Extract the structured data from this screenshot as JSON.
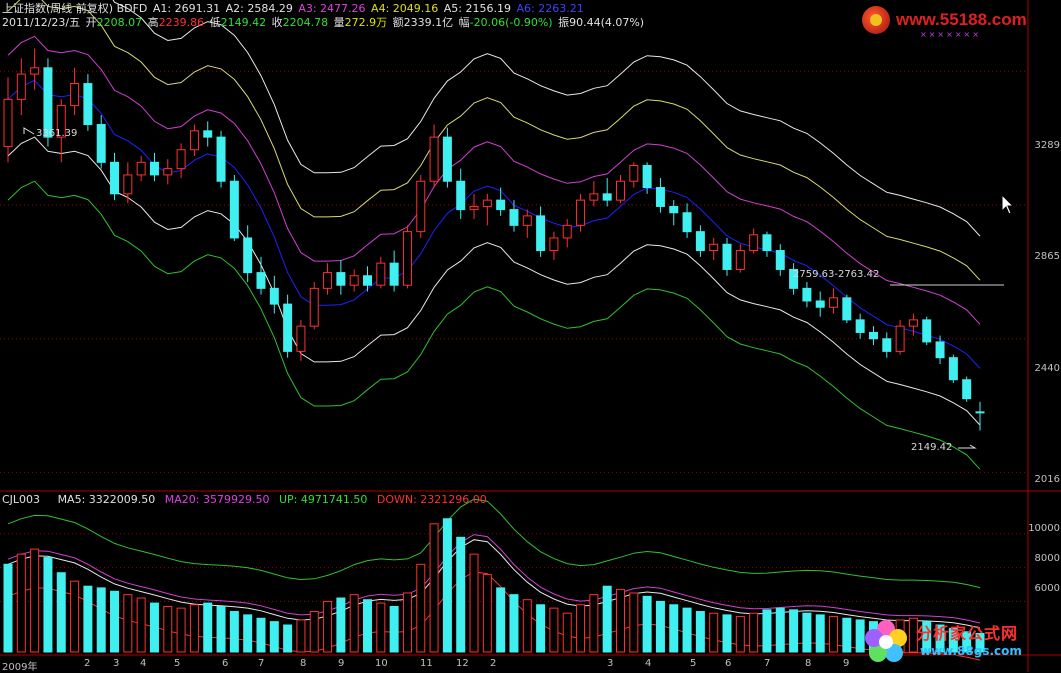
{
  "header": {
    "title": "上证指数(周线 前复权) BDFD",
    "params": [
      {
        "label": "A1: 2691.31",
        "color": "#e0e0e0"
      },
      {
        "label": "A2: 2584.29",
        "color": "#e0e0e0"
      },
      {
        "label": "A3: 2477.26",
        "color": "#e040e0"
      },
      {
        "label": "A4: 2049.16",
        "color": "#e0e000"
      },
      {
        "label": "A5: 2156.19",
        "color": "#e0e0e0"
      },
      {
        "label": "A6: 2263.21",
        "color": "#4040ff"
      }
    ],
    "date": "2011/12/23/五",
    "open": {
      "label": "开",
      "value": "2208.07"
    },
    "high": {
      "label": "高",
      "value": "2239.86"
    },
    "low": {
      "label": "低",
      "value": "2149.42"
    },
    "close": {
      "label": "收",
      "value": "2204.78"
    },
    "volume": {
      "label": "量",
      "value": "272.9万"
    },
    "amount": {
      "label": "额",
      "value": "2339.1亿"
    },
    "change": {
      "label": "幅",
      "value": "-20.06(-0.90%)"
    },
    "swing": {
      "label": "振",
      "value": "90.44(4.07%)"
    }
  },
  "indicator": {
    "name": "CJL003",
    "ma5": "MA5: 3322009.50",
    "ma20": "MA20: 3579929.50",
    "up": "UP: 4971741.50",
    "down": "DOWN: 2321296.00"
  },
  "price_axis": {
    "labels": [
      "3289",
      "2865",
      "2440",
      "2016"
    ],
    "values": [
      3289,
      2865,
      2440,
      2016
    ]
  },
  "volume_axis": {
    "labels": [
      "10000",
      "8000",
      "6000"
    ],
    "values": [
      10000,
      8000,
      6000
    ]
  },
  "time_axis": {
    "labels": [
      "2009年",
      "2",
      "3",
      "4",
      "5",
      "6",
      "7",
      "8",
      "9",
      "10",
      "11",
      "12",
      "2",
      "3",
      "4",
      "5",
      "6",
      "7",
      "8",
      "9"
    ]
  },
  "annotations": {
    "high_mark": "3361.39",
    "low_mark": "2149.42",
    "range_mark": "2759.63-2763.42"
  },
  "logos": {
    "top": "www.55188.com",
    "top_stars": "×××××××",
    "bottom_text": "分析家公式网",
    "bottom_url": "www.88gs.com"
  },
  "colors": {
    "up_candle": "#ff3030",
    "down_candle": "#40f0f0",
    "blue_line": "#2020ff",
    "magenta_line": "#d040d0",
    "yellow_line": "#d8d870",
    "white_line": "#e8e8e8",
    "green_line": "#30c030",
    "frame": "#b00000"
  },
  "chart_data": {
    "type": "candlestick",
    "price_ylim": [
      1960,
      3420
    ],
    "volume_ylim": [
      3000,
      11300
    ],
    "candles": [
      [
        3050,
        3270,
        3000,
        3200
      ],
      [
        3200,
        3330,
        3150,
        3280
      ],
      [
        3280,
        3361,
        3230,
        3300
      ],
      [
        3300,
        3330,
        3050,
        3080
      ],
      [
        3080,
        3200,
        3000,
        3180
      ],
      [
        3180,
        3300,
        3150,
        3250
      ],
      [
        3250,
        3280,
        3100,
        3120
      ],
      [
        3120,
        3150,
        2980,
        3000
      ],
      [
        3000,
        3030,
        2880,
        2900
      ],
      [
        2900,
        3000,
        2870,
        2960
      ],
      [
        2960,
        3020,
        2940,
        3000
      ],
      [
        3000,
        3030,
        2940,
        2960
      ],
      [
        2960,
        3010,
        2930,
        2980
      ],
      [
        2980,
        3060,
        2950,
        3040
      ],
      [
        3040,
        3120,
        3020,
        3100
      ],
      [
        3100,
        3130,
        3050,
        3080
      ],
      [
        3080,
        3100,
        2920,
        2940
      ],
      [
        2940,
        2960,
        2750,
        2760
      ],
      [
        2760,
        2800,
        2620,
        2650
      ],
      [
        2650,
        2700,
        2580,
        2600
      ],
      [
        2600,
        2640,
        2520,
        2550
      ],
      [
        2550,
        2580,
        2380,
        2400
      ],
      [
        2400,
        2500,
        2370,
        2480
      ],
      [
        2480,
        2620,
        2470,
        2600
      ],
      [
        2600,
        2680,
        2580,
        2650
      ],
      [
        2650,
        2690,
        2580,
        2610
      ],
      [
        2610,
        2660,
        2590,
        2640
      ],
      [
        2640,
        2670,
        2590,
        2610
      ],
      [
        2610,
        2700,
        2600,
        2680
      ],
      [
        2680,
        2720,
        2590,
        2610
      ],
      [
        2610,
        2800,
        2600,
        2780
      ],
      [
        2780,
        2960,
        2760,
        2940
      ],
      [
        2940,
        3120,
        2920,
        3080
      ],
      [
        3080,
        3110,
        2920,
        2940
      ],
      [
        2940,
        2980,
        2820,
        2850
      ],
      [
        2850,
        2900,
        2820,
        2860
      ],
      [
        2860,
        2900,
        2800,
        2880
      ],
      [
        2880,
        2920,
        2830,
        2850
      ],
      [
        2850,
        2880,
        2780,
        2800
      ],
      [
        2800,
        2850,
        2760,
        2830
      ],
      [
        2830,
        2860,
        2700,
        2720
      ],
      [
        2720,
        2780,
        2690,
        2760
      ],
      [
        2760,
        2820,
        2730,
        2800
      ],
      [
        2800,
        2900,
        2780,
        2880
      ],
      [
        2880,
        2940,
        2860,
        2900
      ],
      [
        2900,
        2950,
        2860,
        2880
      ],
      [
        2880,
        2960,
        2870,
        2940
      ],
      [
        2940,
        3000,
        2920,
        2990
      ],
      [
        2990,
        3000,
        2900,
        2920
      ],
      [
        2920,
        2950,
        2840,
        2860
      ],
      [
        2860,
        2880,
        2800,
        2840
      ],
      [
        2840,
        2870,
        2760,
        2780
      ],
      [
        2780,
        2800,
        2700,
        2720
      ],
      [
        2720,
        2760,
        2690,
        2740
      ],
      [
        2740,
        2760,
        2640,
        2660
      ],
      [
        2660,
        2740,
        2650,
        2720
      ],
      [
        2720,
        2790,
        2710,
        2770
      ],
      [
        2770,
        2780,
        2700,
        2720
      ],
      [
        2720,
        2740,
        2640,
        2660
      ],
      [
        2660,
        2680,
        2580,
        2600
      ],
      [
        2600,
        2620,
        2540,
        2560
      ],
      [
        2560,
        2590,
        2510,
        2540
      ],
      [
        2540,
        2600,
        2520,
        2570
      ],
      [
        2570,
        2580,
        2490,
        2500
      ],
      [
        2500,
        2520,
        2440,
        2460
      ],
      [
        2460,
        2480,
        2420,
        2440
      ],
      [
        2440,
        2460,
        2380,
        2400
      ],
      [
        2400,
        2500,
        2390,
        2480
      ],
      [
        2480,
        2520,
        2450,
        2500
      ],
      [
        2500,
        2510,
        2420,
        2430
      ],
      [
        2430,
        2450,
        2360,
        2380
      ],
      [
        2380,
        2390,
        2300,
        2310
      ],
      [
        2310,
        2320,
        2240,
        2250
      ],
      [
        2208,
        2240,
        2149,
        2205
      ]
    ],
    "volume": [
      8200,
      8800,
      9100,
      8600,
      7700,
      7200,
      6900,
      6800,
      6600,
      6400,
      6200,
      5900,
      5700,
      5600,
      5800,
      5900,
      5700,
      5400,
      5200,
      5000,
      4800,
      4600,
      4900,
      5400,
      6000,
      6200,
      6400,
      6100,
      5900,
      5700,
      6500,
      8200,
      10600,
      10900,
      9800,
      8800,
      7600,
      6800,
      6400,
      6100,
      5800,
      5600,
      5300,
      5800,
      6400,
      6900,
      6700,
      6500,
      6300,
      6000,
      5800,
      5600,
      5400,
      5300,
      5200,
      5100,
      5300,
      5500,
      5600,
      5500,
      5300,
      5200,
      5100,
      5000,
      4900,
      4800,
      4700,
      4900,
      5000,
      4800,
      4600,
      4400,
      4200,
      4100
    ],
    "volume_up": [
      false,
      true,
      true,
      false,
      false,
      true,
      false,
      false,
      false,
      true,
      true,
      false,
      true,
      true,
      true,
      false,
      false,
      false,
      false,
      false,
      false,
      false,
      true,
      true,
      true,
      false,
      true,
      false,
      true,
      false,
      true,
      true,
      true,
      false,
      false,
      true,
      true,
      false,
      false,
      true,
      false,
      true,
      true,
      true,
      true,
      false,
      true,
      true,
      false,
      false,
      false,
      false,
      false,
      true,
      false,
      true,
      true,
      false,
      false,
      false,
      false,
      false,
      true,
      false,
      false,
      false,
      false,
      true,
      true,
      false,
      false,
      false,
      false,
      false
    ]
  }
}
